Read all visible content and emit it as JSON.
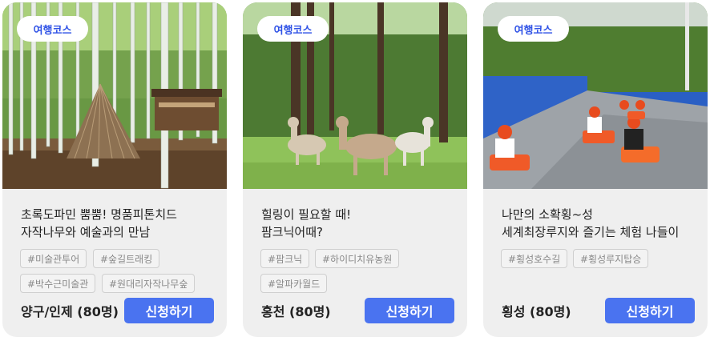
{
  "cards": [
    {
      "category": "여행코스",
      "title_lines": [
        "초록도파민 뿜뿜! 명품피톤치드",
        "자작나무와 예술과의 만남"
      ],
      "hashtags": [
        "#미술관투어",
        "#숲길트래킹",
        "#박수근미술관",
        "#원대리자작나무숲"
      ],
      "location": "양구/인제 (80명)",
      "button": "신청하기",
      "photo": "birch-forest-teepee"
    },
    {
      "category": "여행코스",
      "title_lines": [
        "힐링이 필요할 때!",
        "팜크닉어때?"
      ],
      "hashtags": [
        "#팜크닉",
        "#하이디치유농원",
        "#알파카월드"
      ],
      "location": "홍천 (80명)",
      "button": "신청하기",
      "photo": "alpacas-on-grass"
    },
    {
      "category": "여행코스",
      "title_lines": [
        "나만의 소확횡~성",
        "세계최장루지와 즐기는 체험 나들이"
      ],
      "hashtags": [
        "#횡성호수길",
        "#횡성루지탑승"
      ],
      "location": "횡성 (80명)",
      "button": "신청하기",
      "photo": "luge-riders-on-track"
    }
  ],
  "colors": {
    "accent": "#4a73f0",
    "pill_text": "#2f52e6",
    "card_bg": "#efefef"
  }
}
